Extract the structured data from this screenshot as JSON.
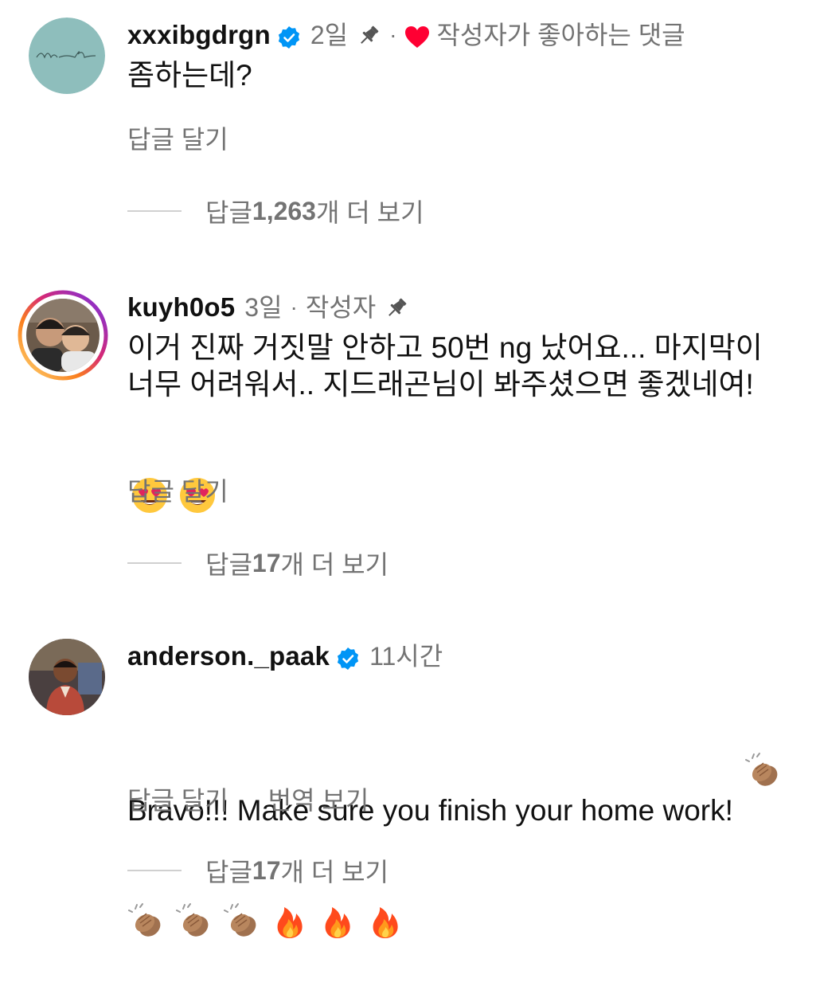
{
  "comments": [
    {
      "username": "xxxibgdrgn",
      "verified": true,
      "time": "2일",
      "pinned": true,
      "author_liked_label": "작성자가 좋아하는 댓글",
      "text": "좀하는데?",
      "reply_label": "답글 달기",
      "more_replies": {
        "prefix": "답글 ",
        "count": "1,263",
        "suffix": "개 더 보기"
      }
    },
    {
      "username": "kuyh0o5",
      "verified": false,
      "time": "3일",
      "author_badge": "작성자",
      "pinned": true,
      "text": "이거 진짜 거짓말 안하고 50번 ng 났어요... 마지막이 너무 어려워서.. 지드래곤님이 봐주셨으면 좋겠네여!",
      "emojis": [
        "heart-eyes-emoji",
        "heart-eyes-emoji"
      ],
      "reply_label": "답글 달기",
      "more_replies": {
        "prefix": "답글 ",
        "count": "17",
        "suffix": "개 더 보기"
      }
    },
    {
      "username": "anderson._paak",
      "verified": true,
      "time": "11시간",
      "text": "Bravo!!! Make sure you finish your home work!",
      "emojis": [
        "clapping-hands-emoji",
        "clapping-hands-emoji",
        "clapping-hands-emoji",
        "clapping-hands-emoji",
        "fire-emoji",
        "fire-emoji",
        "fire-emoji"
      ],
      "reply_label": "답글 달기",
      "translate_label": "번역 보기",
      "more_replies": {
        "prefix": "답글 ",
        "count": "17",
        "suffix": "개 더 보기"
      }
    }
  ],
  "colors": {
    "text": "#111111",
    "meta": "#737373",
    "verified": "#0095f6",
    "heart": "#ff0033"
  }
}
